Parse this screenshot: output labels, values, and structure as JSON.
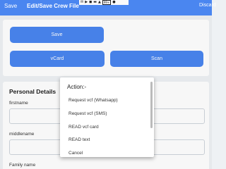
{
  "appbar": {
    "left_button": "Save",
    "title": "Edit/Save Crew File",
    "right_button": "Discard"
  },
  "status_bar": {
    "battery": "99+"
  },
  "actions": {
    "save_label": "Save",
    "vcard_label": "vCard",
    "scan_label": "Scan"
  },
  "details": {
    "title": "Personal Details",
    "firstname_label": "firstname",
    "middlename_label": "middlename",
    "familyname_label": "Family name"
  },
  "popup": {
    "title": "Action:-",
    "items": [
      "Request vcf (Whatsapp)",
      "Request vcf (SMS)",
      "READ vcf card",
      "READ text",
      "Cancel"
    ]
  },
  "colors": {
    "primary": "#4a86f0",
    "background": "#eef1f4"
  }
}
